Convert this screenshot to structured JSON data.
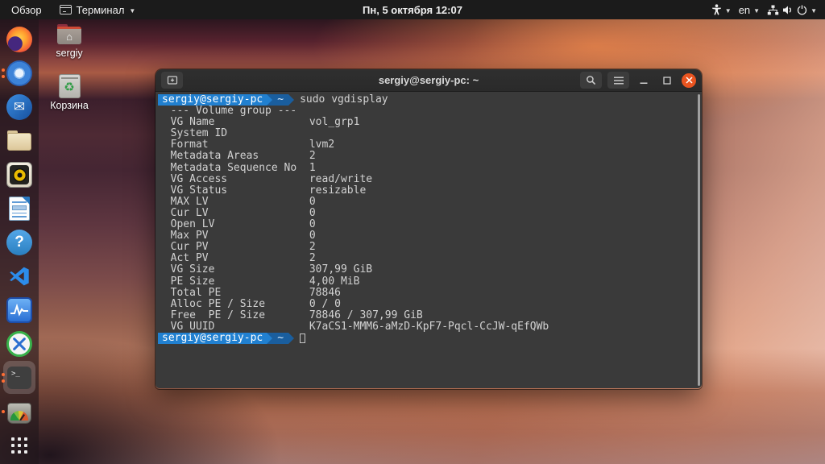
{
  "topbar": {
    "activities_label": "Обзор",
    "app_name": "Терминал",
    "clock": "Пн, 5 октября 12:07",
    "keyboard_layout": "en"
  },
  "desktop_icons": [
    {
      "label": "sergiy",
      "kind": "home-folder"
    },
    {
      "label": "Корзина",
      "kind": "trash"
    }
  ],
  "dock": {
    "items": [
      {
        "name": "firefox",
        "indicators": 0,
        "active": false
      },
      {
        "name": "chromium",
        "indicators": 2,
        "active": false
      },
      {
        "name": "thunderbird",
        "indicators": 0,
        "active": false
      },
      {
        "name": "files",
        "indicators": 0,
        "active": false
      },
      {
        "name": "rhythmbox",
        "indicators": 0,
        "active": false
      },
      {
        "name": "libreoffice-writer",
        "indicators": 0,
        "active": false
      },
      {
        "name": "help",
        "indicators": 0,
        "active": false
      },
      {
        "name": "vscode",
        "indicators": 0,
        "active": false
      },
      {
        "name": "system-monitor",
        "indicators": 0,
        "active": false
      },
      {
        "name": "x-client-app",
        "indicators": 0,
        "active": false
      },
      {
        "name": "terminal",
        "indicators": 2,
        "active": true
      },
      {
        "name": "gauge-app",
        "indicators": 1,
        "active": false
      },
      {
        "name": "show-applications",
        "indicators": 0,
        "active": false
      }
    ],
    "indicator_color": "#ff6d33"
  },
  "window": {
    "title": "sergiy@sergiy-pc: ~",
    "close_color": "#e95420"
  },
  "terminal": {
    "prompt_user": "sergiy@sergiy-pc",
    "prompt_path": "~",
    "command": "sudo vgdisplay",
    "prompt_user_bg": "#2180d0",
    "prompt_path_bg": "#1a5e9e",
    "background": "#3a3a3a",
    "foreground": "#d2d2d2",
    "output_lines": [
      "  --- Volume group ---",
      "  VG Name               vol_grp1",
      "  System ID",
      "  Format                lvm2",
      "  Metadata Areas        2",
      "  Metadata Sequence No  1",
      "  VG Access             read/write",
      "  VG Status             resizable",
      "  MAX LV                0",
      "  Cur LV                0",
      "  Open LV               0",
      "  Max PV                0",
      "  Cur PV                2",
      "  Act PV                2",
      "  VG Size               307,99 GiB",
      "  PE Size               4,00 MiB",
      "  Total PE              78846",
      "  Alloc PE / Size       0 / 0",
      "  Free  PE / Size       78846 / 307,99 GiB",
      "  VG UUID               K7aCS1-MMM6-aMzD-KpF7-Pqcl-CcJW-qEfQWb",
      ""
    ]
  }
}
